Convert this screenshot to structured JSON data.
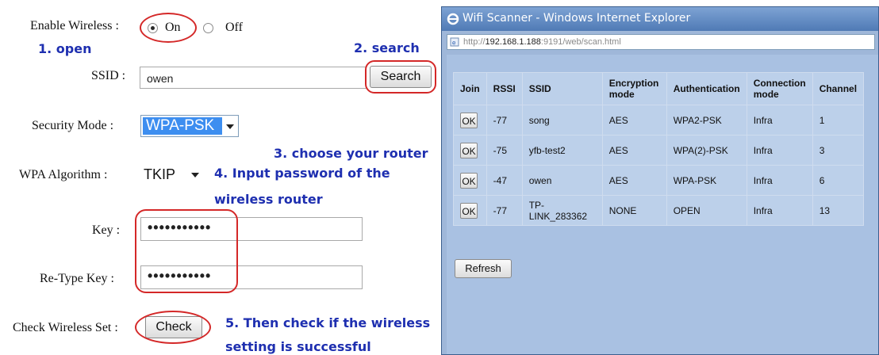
{
  "form": {
    "enable_wireless_label": "Enable Wireless :",
    "on_label": "On",
    "off_label": "Off",
    "ssid_label": "SSID :",
    "ssid_value": "owen",
    "search_button": "Search",
    "security_mode_label": "Security Mode :",
    "security_mode_value": "WPA-PSK",
    "wpa_algorithm_label": "WPA Algorithm :",
    "wpa_algorithm_value": "TKIP",
    "key_label": "Key :",
    "key_value": "•••••••••••",
    "retype_key_label": "Re-Type Key :",
    "retype_key_value": "•••••••••••",
    "check_label": "Check Wireless Set :",
    "check_button": "Check"
  },
  "annotations": {
    "step1": "1. open",
    "step2": "2. search",
    "step3": "3. choose your router",
    "step4_line1": "4. Input password of the",
    "step4_line2": "wireless router",
    "step5_line1": "5. Then check if the wireless",
    "step5_line2": "setting is successful",
    "highlight_color": "#d42828",
    "text_color": "#1e2fb0"
  },
  "scanner": {
    "title": "Wifi Scanner - Windows Internet Explorer",
    "url_prefix": "http://",
    "url_host": "192.168.1.188",
    "url_rest": ":9191/web/scan.html",
    "columns": [
      "Join",
      "RSSI",
      "SSID",
      "Encryption mode",
      "Authentication",
      "Connection mode",
      "Channel"
    ],
    "join_label": "OK",
    "rows": [
      {
        "rssi": "-77",
        "ssid": "song",
        "enc": "AES",
        "auth": "WPA2-PSK",
        "conn": "Infra",
        "channel": "1"
      },
      {
        "rssi": "-75",
        "ssid": "yfb-test2",
        "enc": "AES",
        "auth": "WPA(2)-PSK",
        "conn": "Infra",
        "channel": "3"
      },
      {
        "rssi": "-47",
        "ssid": "owen",
        "enc": "AES",
        "auth": "WPA-PSK",
        "conn": "Infra",
        "channel": "6"
      },
      {
        "rssi": "-77",
        "ssid": "TP-LINK_283362",
        "enc": "NONE",
        "auth": "OPEN",
        "conn": "Infra",
        "channel": "13"
      }
    ],
    "refresh_button": "Refresh"
  }
}
